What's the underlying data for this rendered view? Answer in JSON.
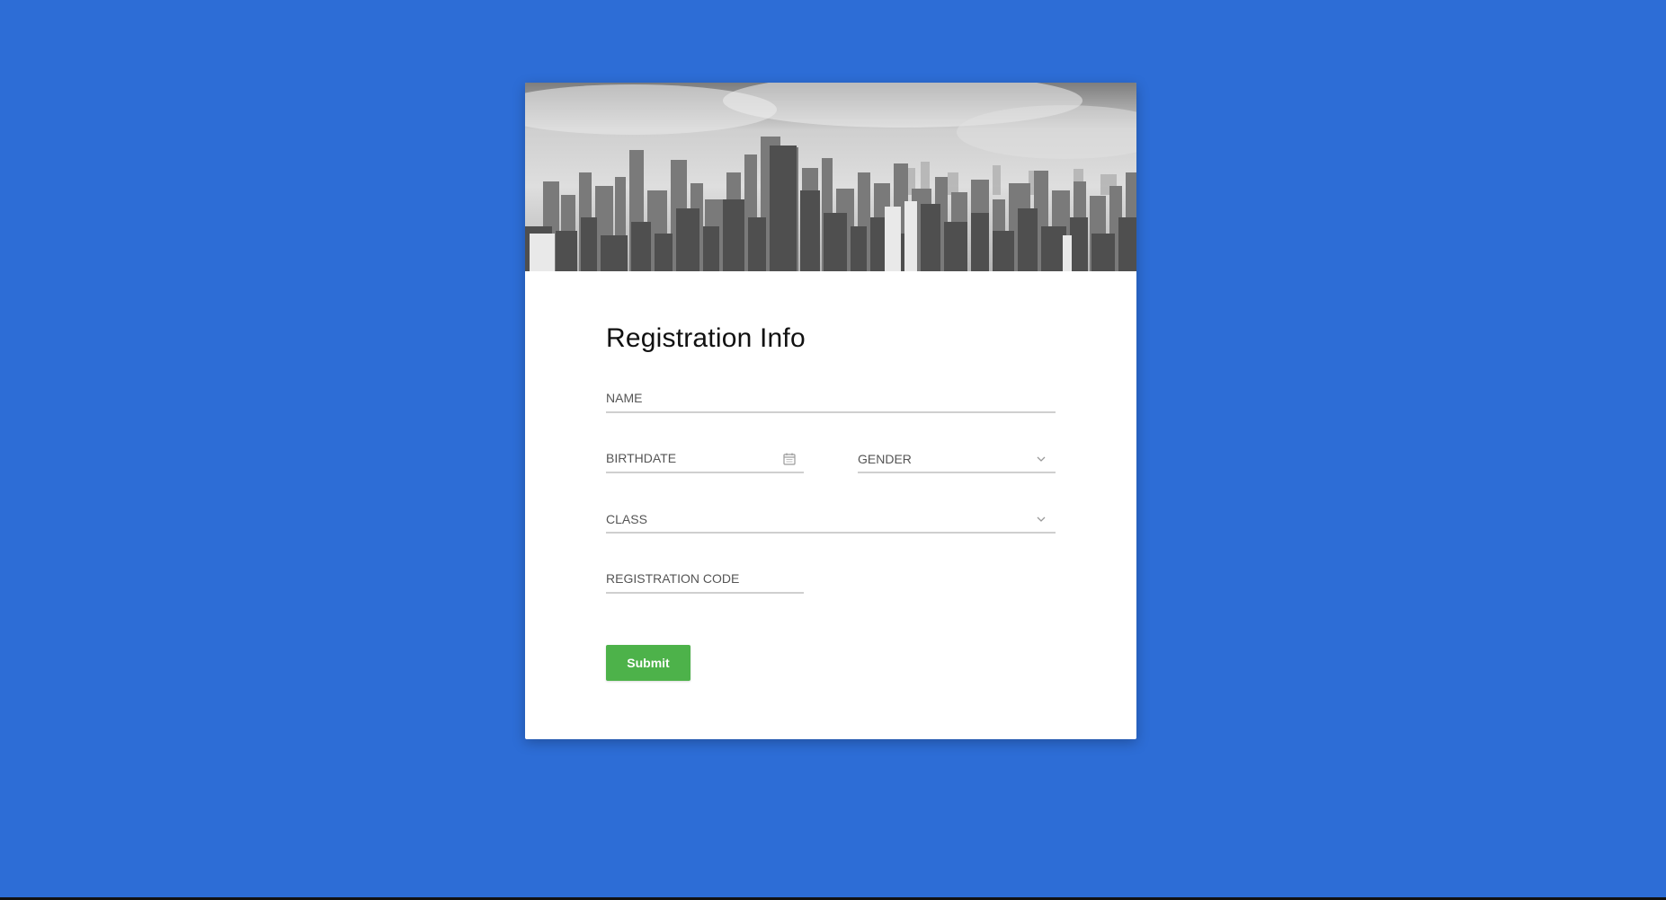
{
  "form": {
    "title": "Registration Info",
    "fields": {
      "name": {
        "placeholder": "NAME",
        "value": ""
      },
      "birthdate": {
        "placeholder": "BIRTHDATE",
        "value": "",
        "icon": "calendar-icon"
      },
      "gender": {
        "placeholder": "GENDER",
        "selected": "",
        "icon": "chevron-down-icon"
      },
      "class": {
        "placeholder": "CLASS",
        "selected": "",
        "icon": "chevron-down-icon"
      },
      "registration_code": {
        "placeholder": "REGISTRATION CODE",
        "value": ""
      }
    },
    "submit_label": "Submit"
  },
  "colors": {
    "background": "#2d6dd6",
    "card": "#ffffff",
    "submit": "#4db24a",
    "field_underline": "#cfcfcf"
  }
}
